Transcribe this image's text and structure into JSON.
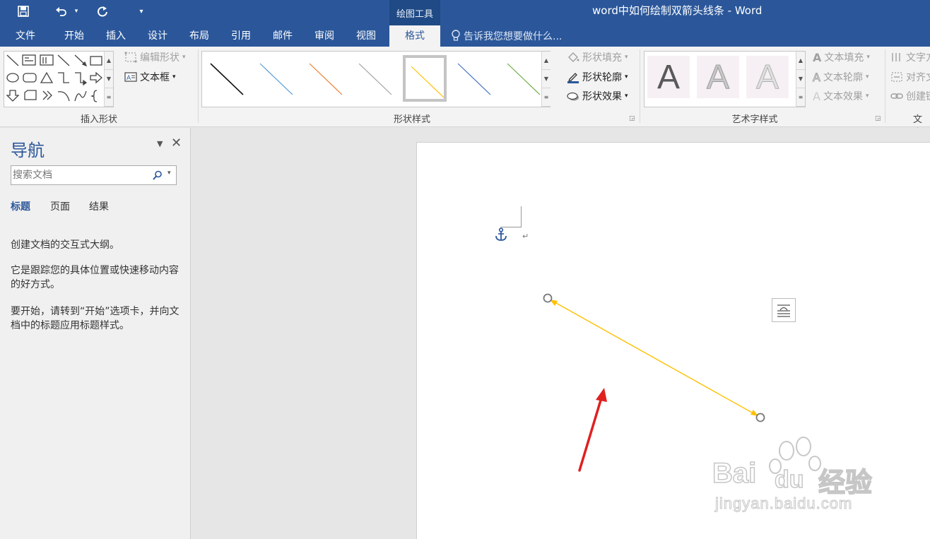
{
  "window": {
    "doc_title": "word中如何绘制双箭头线条 - Word",
    "context_label": "绘图工具"
  },
  "tabs": [
    "文件",
    "开始",
    "插入",
    "设计",
    "布局",
    "引用",
    "邮件",
    "审阅",
    "视图",
    "格式"
  ],
  "active_tab": "格式",
  "tell_me": "告诉我您想要做什么...",
  "ribbon": {
    "insert_shapes": {
      "label": "插入形状",
      "edit_shape": "编辑形状",
      "text_box": "文本框"
    },
    "shape_styles": {
      "label": "形状样式",
      "fill": "形状填充",
      "outline": "形状轮廓",
      "effects": "形状效果",
      "line_colors": [
        "#111111",
        "#5b9bd5",
        "#ed7d31",
        "#a5a5a5",
        "#ffc000",
        "#4472c4",
        "#70ad47"
      ],
      "selected_index": 4
    },
    "wordart": {
      "label": "艺术字样式",
      "letter": "A",
      "text_fill": "文本填充",
      "text_outline": "文本轮廓",
      "text_effects": "文本效果"
    },
    "text_group": {
      "label": "文本",
      "text_direction": "文字方",
      "align_text": "对齐文",
      "create_link": "创建链"
    }
  },
  "nav": {
    "title": "导航",
    "search_placeholder": "搜索文档",
    "tabs": [
      "标题",
      "页面",
      "结果"
    ],
    "active_tab": "标题",
    "hint1": "创建文档的交互式大纲。",
    "hint2": "它是跟踪您的具体位置或快速移动内容的好方式。",
    "hint3": "要开始，请转到“开始”选项卡，并向文档中的标题应用标题样式。"
  },
  "document": {
    "paragraph_mark": "↵",
    "line_color": "#ffc000",
    "annotation_arrow_color": "#e02020"
  },
  "watermark": {
    "brand": "Bai",
    "brand2": "du",
    "jy": "经验",
    "url": "jingyan.baidu.com"
  },
  "colors": {
    "accent": "#2b579a"
  }
}
